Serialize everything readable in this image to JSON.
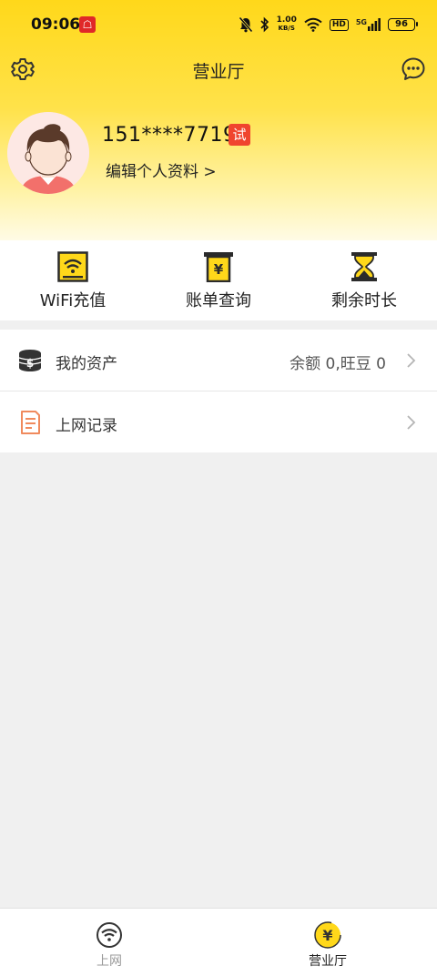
{
  "status_bar": {
    "time": "09:06",
    "app_badge": "☖",
    "net_speed_value": "1.00",
    "net_speed_unit": "KB/S",
    "hd_label": "HD",
    "network_label": "5G",
    "battery": "96"
  },
  "header": {
    "title": "营业厅",
    "settings_icon": "gear-icon",
    "message_icon": "chat-bubble-icon"
  },
  "profile": {
    "phone": "151****7719",
    "badge": "试",
    "edit_link": "编辑个人资料 >"
  },
  "quick_actions": [
    {
      "label": "WiFi充值",
      "icon": "wifi-recharge-icon"
    },
    {
      "label": "账单查询",
      "icon": "bill-scroll-icon"
    },
    {
      "label": "剩余时长",
      "icon": "hourglass-icon"
    }
  ],
  "list": [
    {
      "label": "我的资产",
      "value": "余额 0,旺豆 0",
      "icon": "coins-icon"
    },
    {
      "label": "上网记录",
      "value": "",
      "icon": "document-icon"
    }
  ],
  "tabbar": [
    {
      "label": "上网",
      "icon": "wifi-icon",
      "active": false
    },
    {
      "label": "营业厅",
      "icon": "yen-coin-icon",
      "active": true
    }
  ],
  "colors": {
    "brand_yellow": "#ffd81a",
    "badge_red": "#f0452e",
    "icon_dark": "#2b2b2b",
    "record_orange": "#f08a5d",
    "tab_inactive": "#999999",
    "tab_active": "#222222"
  }
}
